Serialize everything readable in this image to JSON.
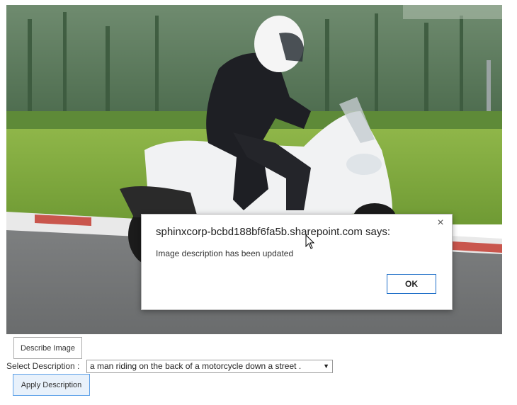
{
  "photo": {
    "description_icon": "motorcycle-photo",
    "alt": "man on white scooter"
  },
  "dialog": {
    "title": "sphinxcorp-bcbd188bf6fa5b.sharepoint.com says:",
    "message": "Image description has been updated",
    "ok_label": "OK",
    "close_glyph": "×"
  },
  "controls": {
    "describe_label": "Describe Image",
    "select_label": "Select Description :",
    "select_value": "a man riding on the back of a motorcycle down a street .",
    "select_arrow": "▼",
    "apply_label": "Apply Description"
  }
}
